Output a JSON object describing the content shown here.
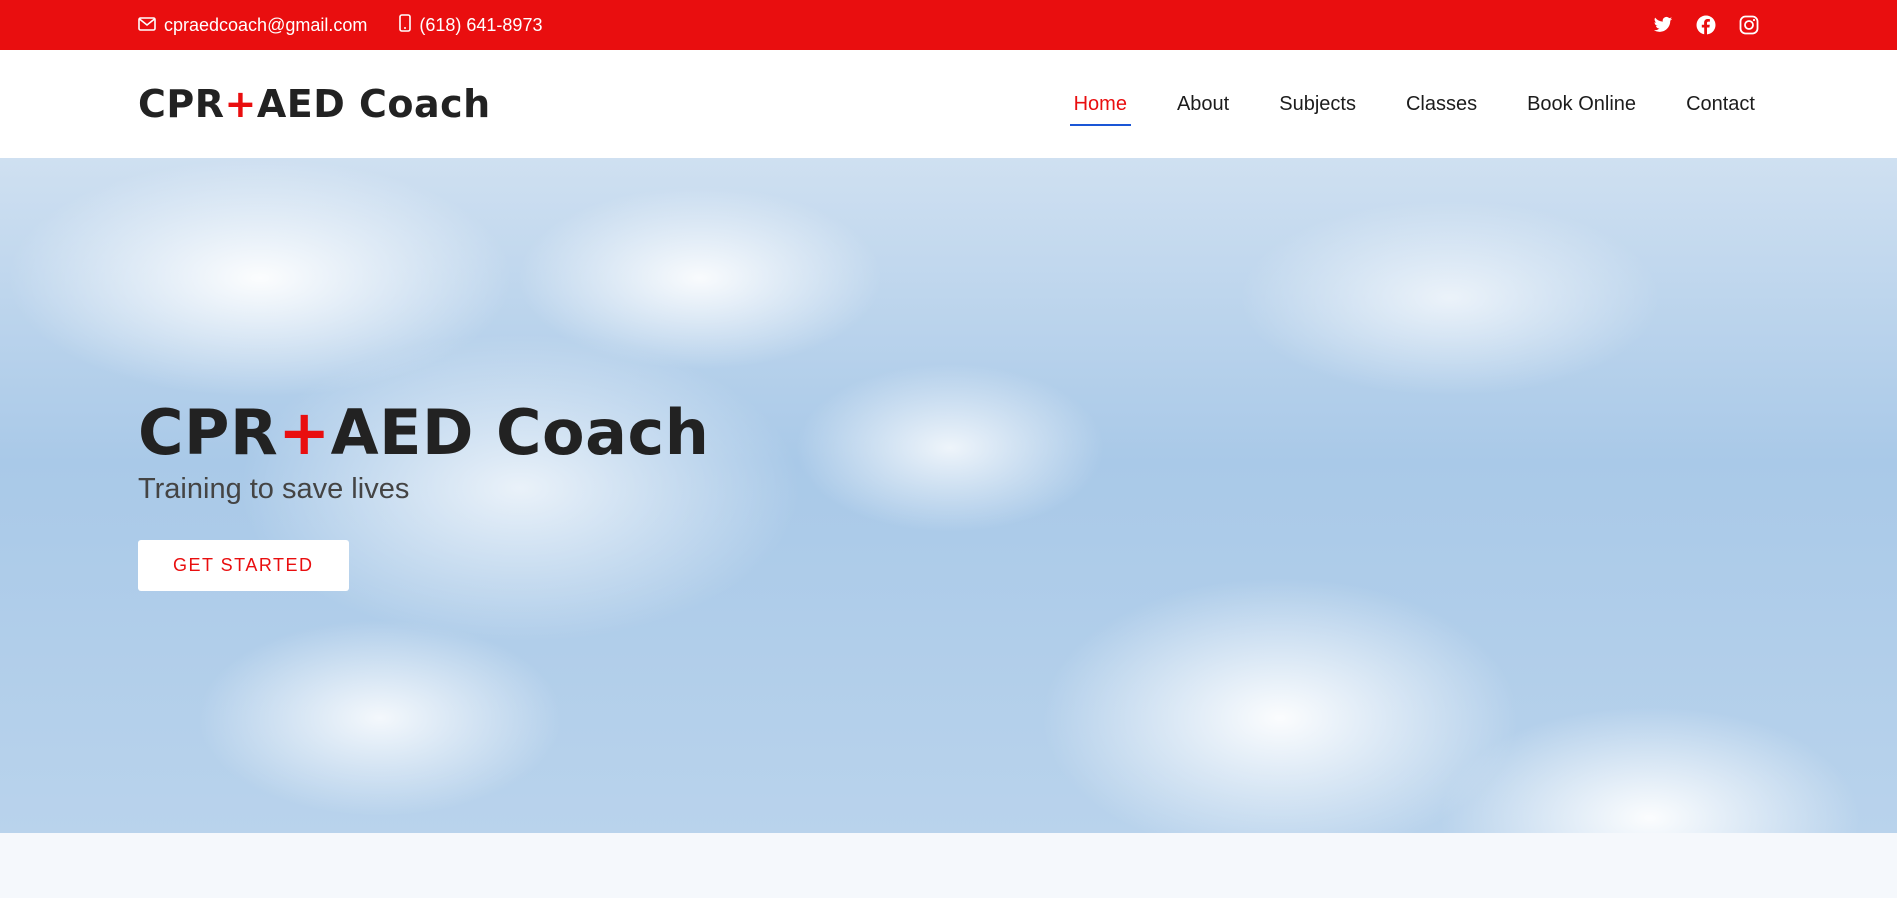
{
  "topbar": {
    "email": "cpraedcoach@gmail.com",
    "phone": "(618) 641-8973",
    "email_icon": "envelope-icon",
    "phone_icon": "phone-icon",
    "social": [
      "twitter-icon",
      "facebook-icon",
      "instagram-icon"
    ],
    "background_color": "#e90e0f"
  },
  "header": {
    "logo_left": "CPR",
    "logo_plus": "+",
    "logo_right": "AED Coach",
    "nav": [
      "Home",
      "About",
      "Subjects",
      "Classes",
      "Book Online",
      "Contact"
    ],
    "active_nav": "Home",
    "accent_color": "#e90e0f",
    "active_underline_color": "#1a56d6"
  },
  "hero": {
    "title_left": "CPR",
    "title_plus": "+",
    "title_right": "AED Coach",
    "subtitle": "Training to save lives",
    "cta_label": "GET STARTED"
  }
}
